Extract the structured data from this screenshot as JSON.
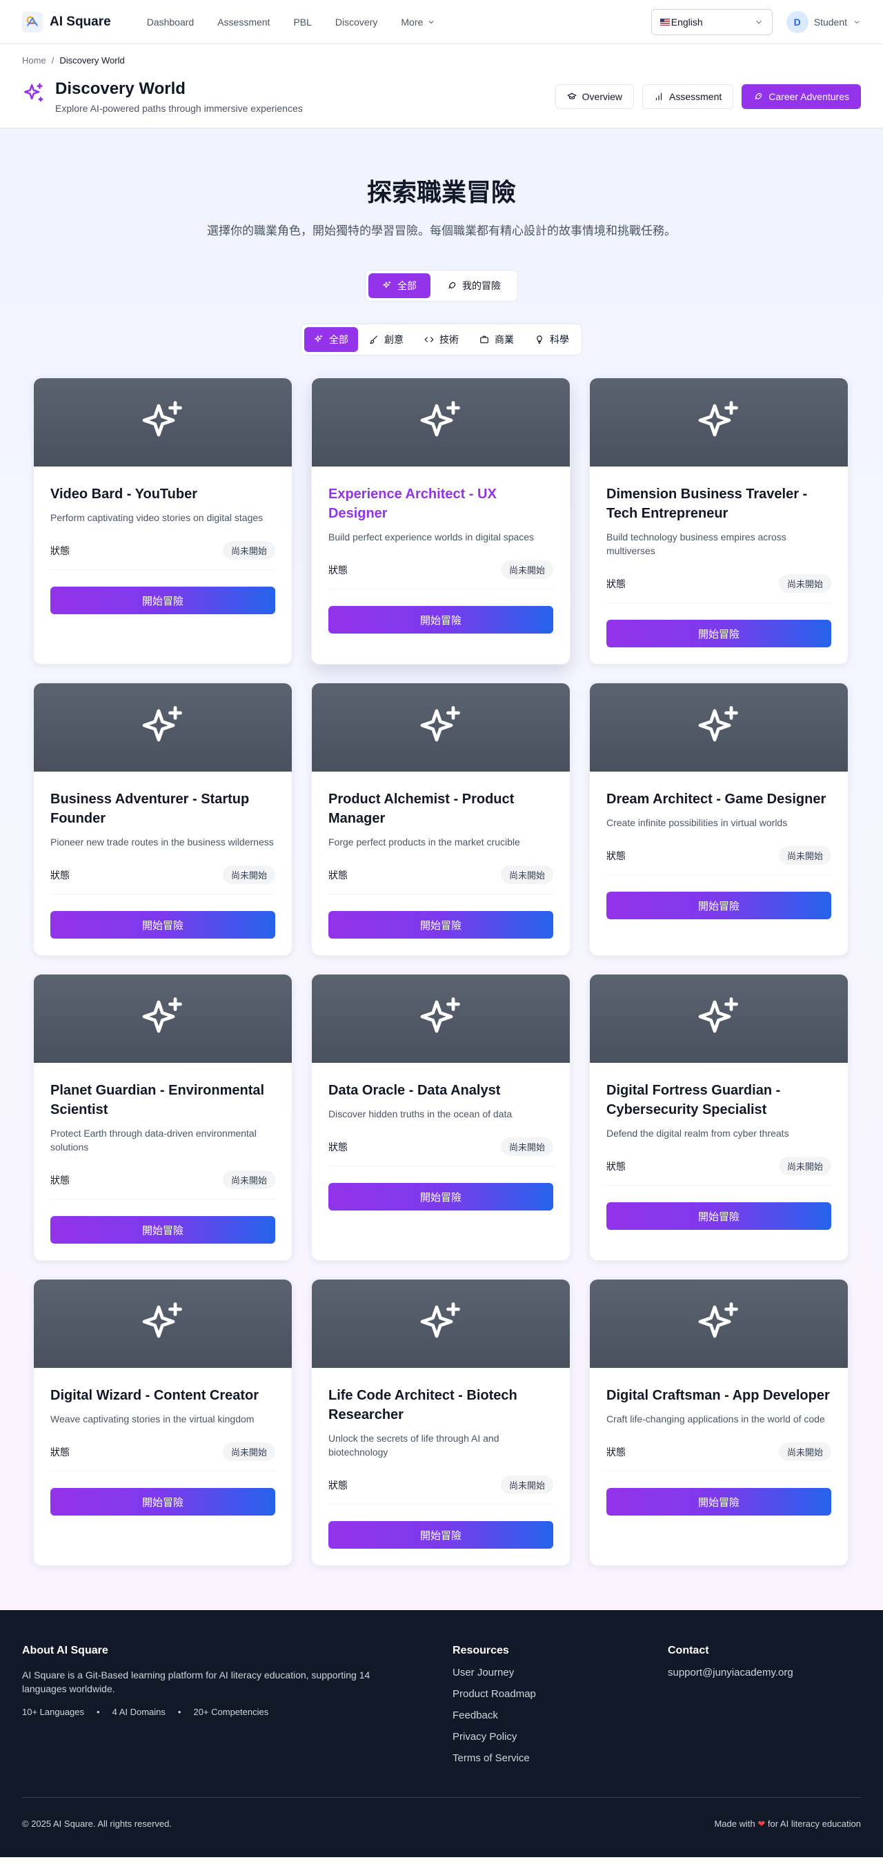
{
  "nav": {
    "logo_text": "AI Square",
    "links": [
      "Dashboard",
      "Assessment",
      "PBL",
      "Discovery",
      "More"
    ],
    "language": "English",
    "user_initial": "D",
    "user_name": "Student"
  },
  "header": {
    "breadcrumb_home": "Home",
    "breadcrumb_sep": "/",
    "breadcrumb_current": "Discovery World",
    "title": "Discovery World",
    "subtitle": "Explore AI-powered paths through immersive experiences",
    "actions": [
      "Overview",
      "Assessment",
      "Career Adventures"
    ]
  },
  "hero": {
    "title": "探索職業冒險",
    "subtitle": "選擇你的職業角色，開始獨特的學習冒險。每個職業都有精心設計的故事情境和挑戰任務。"
  },
  "tabs": [
    "全部",
    "我的冒險"
  ],
  "categories": [
    "全部",
    "創意",
    "技術",
    "商業",
    "科學"
  ],
  "card_common": {
    "status_label": "狀態",
    "status_value": "尚未開始",
    "button_label": "開始冒險"
  },
  "careers": [
    {
      "title": "Video Bard - YouTuber",
      "desc": "Perform captivating video stories on digital stages"
    },
    {
      "title": "Experience Architect - UX Designer",
      "desc": "Build perfect experience worlds in digital spaces"
    },
    {
      "title": "Dimension Business Traveler - Tech Entrepreneur",
      "desc": "Build technology business empires across multiverses"
    },
    {
      "title": "Business Adventurer - Startup Founder",
      "desc": "Pioneer new trade routes in the business wilderness"
    },
    {
      "title": "Product Alchemist - Product Manager",
      "desc": "Forge perfect products in the market crucible"
    },
    {
      "title": "Dream Architect - Game Designer",
      "desc": "Create infinite possibilities in virtual worlds"
    },
    {
      "title": "Planet Guardian - Environmental Scientist",
      "desc": "Protect Earth through data-driven environmental solutions"
    },
    {
      "title": "Data Oracle - Data Analyst",
      "desc": "Discover hidden truths in the ocean of data"
    },
    {
      "title": "Digital Fortress Guardian - Cybersecurity Specialist",
      "desc": "Defend the digital realm from cyber threats"
    },
    {
      "title": "Digital Wizard - Content Creator",
      "desc": "Weave captivating stories in the virtual kingdom"
    },
    {
      "title": "Life Code Architect - Biotech Researcher",
      "desc": "Unlock the secrets of life through AI and biotechnology"
    },
    {
      "title": "Digital Craftsman - App Developer",
      "desc": "Craft life-changing applications in the world of code"
    }
  ],
  "footer": {
    "about_title": "About AI Square",
    "about_text": "AI Square is a Git-Based learning platform for AI literacy education, supporting 14 languages worldwide.",
    "stats": [
      "10+ Languages",
      "4 AI Domains",
      "20+ Competencies"
    ],
    "stat_sep": "•",
    "resources_title": "Resources",
    "resources": [
      "User Journey",
      "Product Roadmap",
      "Feedback",
      "Privacy Policy",
      "Terms of Service"
    ],
    "contact_title": "Contact",
    "contact_email": "support@junyiacademy.org",
    "copyright": "© 2025 AI Square. All rights reserved.",
    "made_with_prefix": "Made with",
    "made_with_suffix": "for AI literacy education"
  },
  "colors": {
    "accent": "#9333ea",
    "gradient_end": "#2563eb",
    "footer_bg": "#111827",
    "card_header": "#4b5260"
  }
}
